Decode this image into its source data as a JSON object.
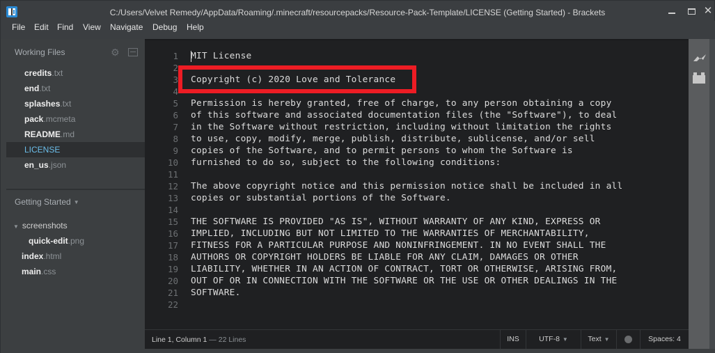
{
  "window": {
    "title": "C:/Users/Velvet Remedy/AppData/Roaming/.minecraft/resourcepacks/Resource-Pack-Template/LICENSE (Getting Started) - Brackets",
    "controls": {
      "minimize": "minimize",
      "maximize": "maximize",
      "close": "✕"
    }
  },
  "menu": [
    "File",
    "Edit",
    "Find",
    "View",
    "Navigate",
    "Debug",
    "Help"
  ],
  "sidebar": {
    "working_files_label": "Working Files",
    "working_files": [
      {
        "name": "credits",
        "ext": ".txt",
        "selected": false
      },
      {
        "name": "end",
        "ext": ".txt",
        "selected": false
      },
      {
        "name": "splashes",
        "ext": ".txt",
        "selected": false
      },
      {
        "name": "pack",
        "ext": ".mcmeta",
        "selected": false
      },
      {
        "name": "README",
        "ext": ".md",
        "selected": false
      },
      {
        "name": "LICENSE",
        "ext": "",
        "selected": true
      },
      {
        "name": "en_us",
        "ext": ".json",
        "selected": false
      }
    ],
    "project_label": "Getting Started",
    "project_tree": [
      {
        "type": "folder",
        "name": "screenshots",
        "ext": "",
        "expanded": true,
        "depth": 0
      },
      {
        "type": "file",
        "name": "quick-edit",
        "ext": ".png",
        "depth": 1
      },
      {
        "type": "file",
        "name": "index",
        "ext": ".html",
        "depth": 0
      },
      {
        "type": "file",
        "name": "main",
        "ext": ".css",
        "depth": 0
      }
    ]
  },
  "editor": {
    "lines": [
      "MIT License",
      "",
      "Copyright (c) 2020 Love and Tolerance",
      "",
      "Permission is hereby granted, free of charge, to any person obtaining a copy",
      "of this software and associated documentation files (the \"Software\"), to deal",
      "in the Software without restriction, including without limitation the rights",
      "to use, copy, modify, merge, publish, distribute, sublicense, and/or sell",
      "copies of the Software, and to permit persons to whom the Software is",
      "furnished to do so, subject to the following conditions:",
      "",
      "The above copyright notice and this permission notice shall be included in all",
      "copies or substantial portions of the Software.",
      "",
      "THE SOFTWARE IS PROVIDED \"AS IS\", WITHOUT WARRANTY OF ANY KIND, EXPRESS OR",
      "IMPLIED, INCLUDING BUT NOT LIMITED TO THE WARRANTIES OF MERCHANTABILITY,",
      "FITNESS FOR A PARTICULAR PURPOSE AND NONINFRINGEMENT. IN NO EVENT SHALL THE",
      "AUTHORS OR COPYRIGHT HOLDERS BE LIABLE FOR ANY CLAIM, DAMAGES OR OTHER",
      "LIABILITY, WHETHER IN AN ACTION OF CONTRACT, TORT OR OTHERWISE, ARISING FROM,",
      "OUT OF OR IN CONNECTION WITH THE SOFTWARE OR THE USE OR OTHER DEALINGS IN THE",
      "SOFTWARE.",
      ""
    ],
    "highlight_color": "#ed1c24"
  },
  "statusbar": {
    "position": "Line 1, Column 1",
    "separator": " — ",
    "line_count": "22 Lines",
    "mode": "INS",
    "encoding": "UTF-8",
    "language": "Text",
    "indent": "Spaces:",
    "indent_size": "4"
  },
  "colors": {
    "accent": "#6bbeea",
    "editor_bg": "#1f2022",
    "sidebar_bg": "#3c3f41",
    "highlight_box": "#ed1c24"
  }
}
